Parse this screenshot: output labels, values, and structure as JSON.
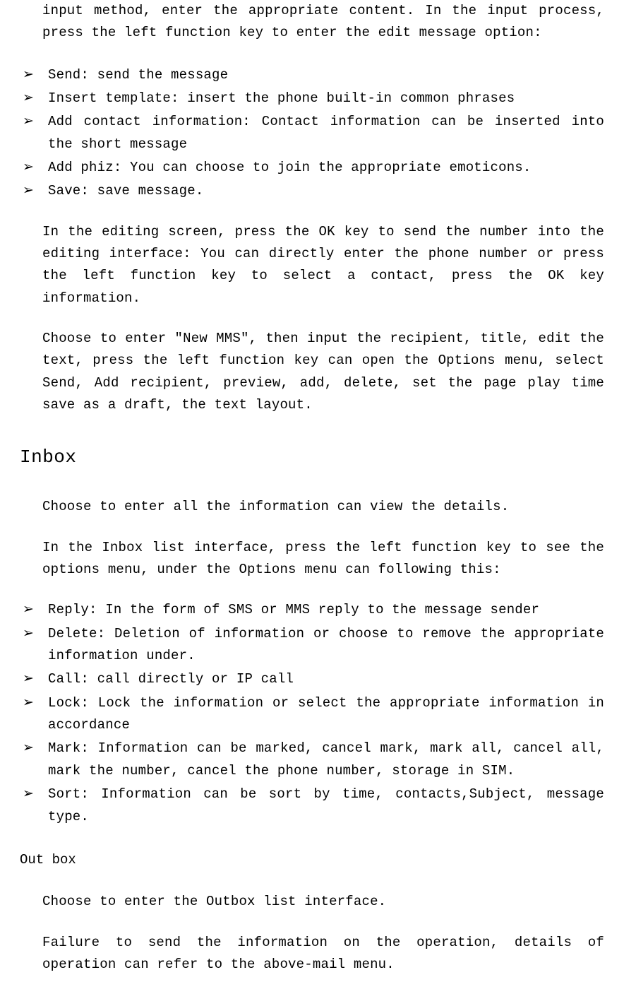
{
  "intro": "input method, enter the appropriate content. In the input process, press the left function key to enter the edit message option:",
  "bullets1": [
    "Send: send the message",
    "Insert template: insert the phone built-in common phrases",
    "Add contact information: Contact information can be inserted into the short message",
    "Add phiz: You can choose to join the appropriate emoticons.",
    "Save: save message."
  ],
  "para_editing": "In the editing screen, press the OK key to send the number into the editing interface: You can directly enter the phone number or press the left function key to select a contact, press the OK key information.",
  "para_newmms": "Choose to enter \"New MMS\", then input the recipient, title, edit the text, press the left function key can open the Options menu, select Send, Add recipient, preview, add, delete, set the page play time save as a draft, the text layout.",
  "heading_inbox": "Inbox",
  "inbox_para1": "Choose to enter all the information can view the details.",
  "inbox_para2": "In the Inbox list interface, press the left function key to see the options menu, under the Options menu can following this:",
  "bullets2": [
    "Reply: In the form of SMS or MMS reply to the message sender",
    "Delete: Deletion of information or choose to remove the appropriate information under.",
    "Call: call directly or IP call",
    "Lock: Lock the information or select the appropriate information in accordance",
    "Mark: Information can be marked, cancel mark, mark all, cancel all, mark the number, cancel the phone number, storage in SIM.",
    "Sort: Information can be sort by time, contacts,Subject, message type."
  ],
  "heading_outbox": "Out box",
  "outbox_para1": "Choose to enter the Outbox list interface.",
  "outbox_para2": "Failure to send the information on the operation, details of operation can refer to the above-mail menu."
}
